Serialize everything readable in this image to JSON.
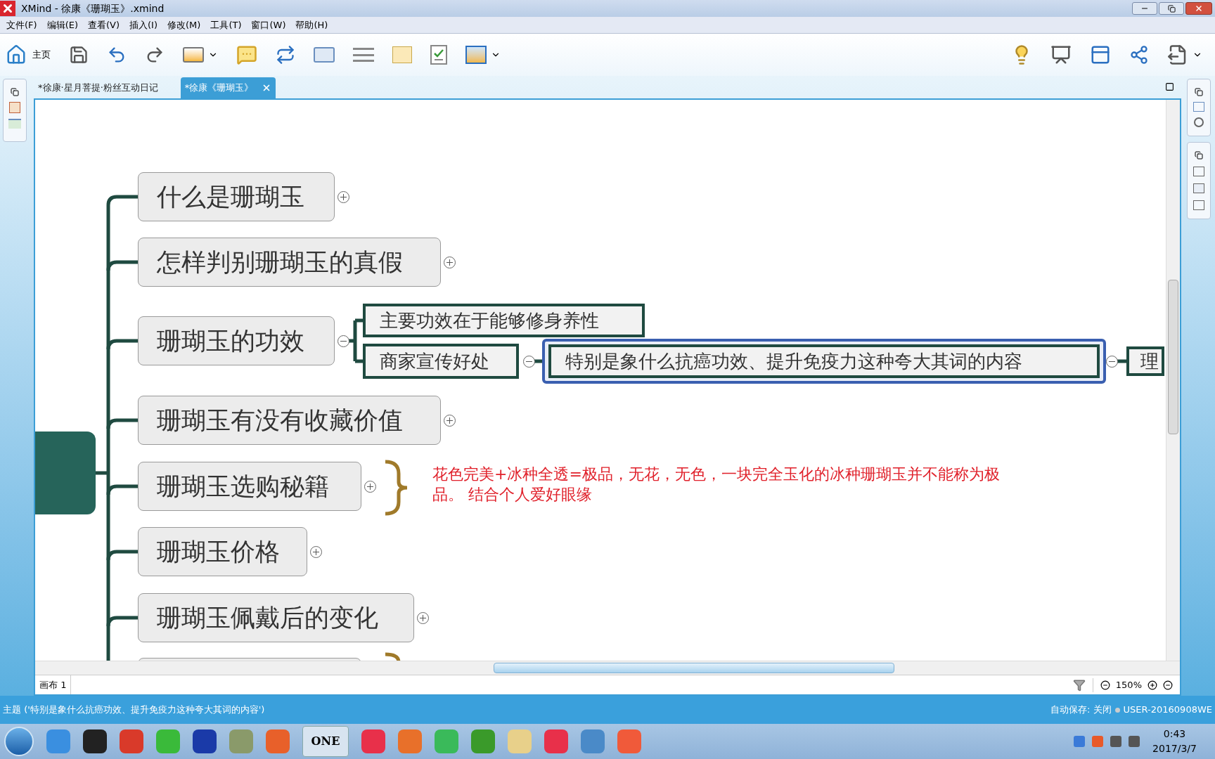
{
  "window": {
    "title": "XMind - 徐康《珊瑚玉》.xmind"
  },
  "menu": [
    "文件(F)",
    "编辑(E)",
    "查看(V)",
    "插入(I)",
    "修改(M)",
    "工具(T)",
    "窗口(W)",
    "帮助(H)"
  ],
  "toolbar": {
    "home_label": "主页"
  },
  "tabs": [
    {
      "label": "*徐康·星月菩提·粉丝互动日记",
      "selected": false
    },
    {
      "label": "*徐康《珊瑚玉》",
      "selected": true
    }
  ],
  "topics": [
    {
      "text": "什么是珊瑚玉",
      "expanded": false
    },
    {
      "text": "怎样判别珊瑚玉的真假",
      "expanded": false
    },
    {
      "text": "珊瑚玉的功效",
      "expanded": true,
      "children": [
        {
          "text": "主要功效在于能够修身养性"
        },
        {
          "text": "商家宣传好处",
          "expanded": true,
          "children": [
            {
              "text": "特别是象什么抗癌功效、提升免疫力这种夸大其词的内容",
              "selected": true,
              "expanded": true,
              "children": [
                {
                  "text": "理"
                }
              ]
            }
          ]
        }
      ]
    },
    {
      "text": "珊瑚玉有没有收藏价值",
      "expanded": false
    },
    {
      "text": "珊瑚玉选购秘籍",
      "expanded": false,
      "summary": "花色完美+冰种全透=极品，无花，无色，一块完全玉化的冰种珊瑚玉并不能称为极品。 结合个人爱好眼缘"
    },
    {
      "text": "珊瑚玉价格",
      "expanded": false
    },
    {
      "text": "珊瑚玉佩戴后的变化",
      "expanded": false
    }
  ],
  "sheet_tab": "画布 1",
  "zoom": "150%",
  "status_text": "主题 ('特别是象什么抗癌功效、提升免疫力这种夸大其词的内容')",
  "autosave": "自动保存: 关闭",
  "user": "USER-20160908WE",
  "taskbar": {
    "app_label": "ONE",
    "time": "0:43",
    "date": "2017/3/7"
  }
}
